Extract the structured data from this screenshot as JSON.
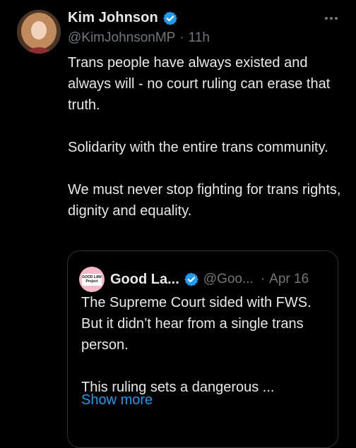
{
  "tweet": {
    "author": {
      "name": "Kim Johnson",
      "handle": "@KimJohnsonMP",
      "separator": "·",
      "time": "11h"
    },
    "paragraphs": [
      "Trans people have always existed and always will - no court ruling can erase that truth.",
      "Solidarity with the entire trans community.",
      "We must never stop fighting for trans rights, dignity and equality."
    ]
  },
  "quoted": {
    "name": "Good La...",
    "handle": "@Goo...",
    "separator": "·",
    "date": "Apr 16",
    "logo_line1": "GOOD LAW",
    "logo_line2": "Project",
    "paragraphs": [
      "The Supreme Court sided with FWS.  But it didn’t hear from a single trans person.",
      "This ruling sets a dangerous ..."
    ],
    "show_more": "Show more"
  },
  "icons": {
    "verified": "verified-badge-icon",
    "more": "more-options-icon"
  },
  "colors": {
    "background": "#000000",
    "text": "#e7e9ea",
    "muted": "#71767b",
    "link": "#1d9bf0",
    "border": "#2f3336",
    "quote_avatar": "#f7b8c8"
  }
}
